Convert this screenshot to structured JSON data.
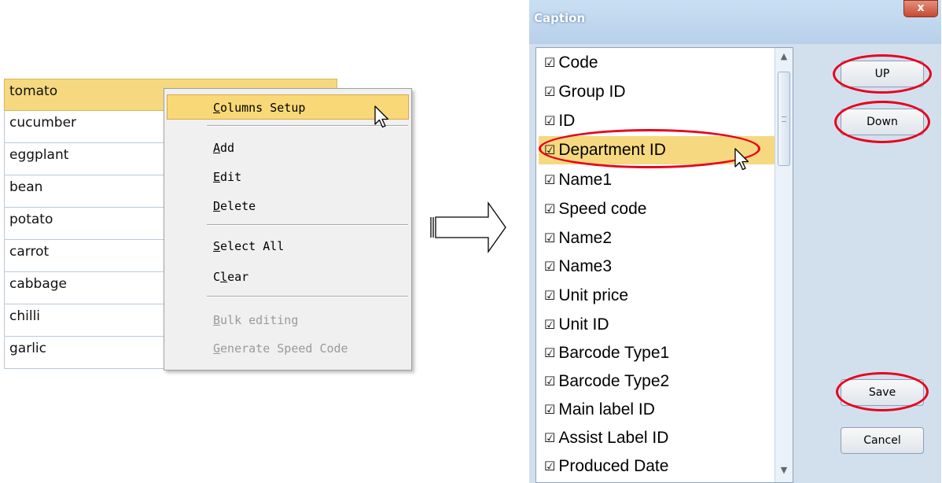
{
  "vegetable_list": {
    "items": [
      "tomato",
      "cucumber",
      "eggplant",
      "bean",
      "potato",
      "carrot",
      "cabbage",
      "chilli",
      "garlic"
    ]
  },
  "context_menu": {
    "columns_setup": {
      "pre": "",
      "key": "C",
      "post": "olumns Setup"
    },
    "add": {
      "pre": "",
      "key": "A",
      "post": "dd"
    },
    "edit": {
      "pre": "",
      "key": "E",
      "post": "dit"
    },
    "delete": {
      "pre": "",
      "key": "D",
      "post": "elete"
    },
    "select_all": {
      "pre": "",
      "key": "S",
      "post": "elect All"
    },
    "clear": {
      "pre": "C",
      "key": "l",
      "post": "ear"
    },
    "bulk_editing": {
      "pre": "",
      "key": "B",
      "post": "ulk editing"
    },
    "generate_speed_code": {
      "pre": "",
      "key": "G",
      "post": "enerate Speed Code"
    }
  },
  "dialog": {
    "title": "Caption",
    "close_glyph": "x",
    "checkbox_glyph": "☑",
    "items": [
      "Code",
      "Group ID",
      "ID",
      "Department ID",
      "Name1",
      "Speed code",
      "Name2",
      "Name3",
      "Unit price",
      "Unit ID",
      "Barcode Type1",
      "Barcode Type2",
      "Main label ID",
      "Assist Label ID",
      "Produced Date"
    ],
    "selected_index": 3,
    "buttons": {
      "up": "UP",
      "down": "Down",
      "save": "Save",
      "cancel": "Cancel"
    }
  },
  "colors": {
    "highlight": "#f6d880",
    "annotation_red": "#e8001c",
    "dialog_bg": "#d2e0ee"
  }
}
